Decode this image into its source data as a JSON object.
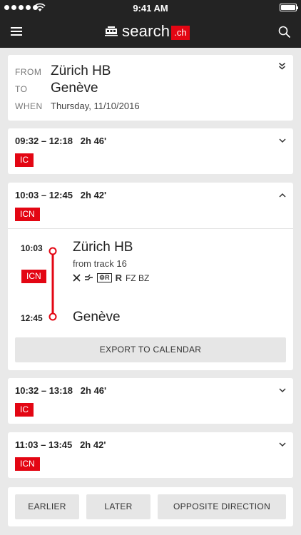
{
  "status_bar": {
    "time": "9:41 AM"
  },
  "brand": {
    "name": "search",
    "tld": ".ch"
  },
  "query": {
    "from_label": "FROM",
    "from_value": "Zürich HB",
    "to_label": "TO",
    "to_value": "Genève",
    "when_label": "WHEN",
    "when_value": "Thursday, 11/10/2016"
  },
  "connections": [
    {
      "times": "09:32 – 12:18",
      "duration": "2h 46'",
      "train": "IC"
    },
    {
      "times": "10:03 – 12:45",
      "duration": "2h 42'",
      "train": "ICN",
      "detail": {
        "dep_time": "10:03",
        "dep_station": "Zürich HB",
        "track": "from track 16",
        "train": "ICN",
        "arr_time": "12:45",
        "arr_station": "Genève",
        "features": {
          "res": "R",
          "classes": "FZ BZ"
        },
        "export_label": "EXPORT TO CALENDAR"
      }
    },
    {
      "times": "10:32 – 13:18",
      "duration": "2h 46'",
      "train": "IC"
    },
    {
      "times": "11:03 – 13:45",
      "duration": "2h 42'",
      "train": "ICN"
    }
  ],
  "footer": {
    "earlier": "EARLIER",
    "later": "LATER",
    "opposite": "OPPOSITE DIRECTION"
  },
  "colors": {
    "accent": "#e30613",
    "nav_bg": "#232323",
    "page_bg": "#e9e9e9"
  }
}
